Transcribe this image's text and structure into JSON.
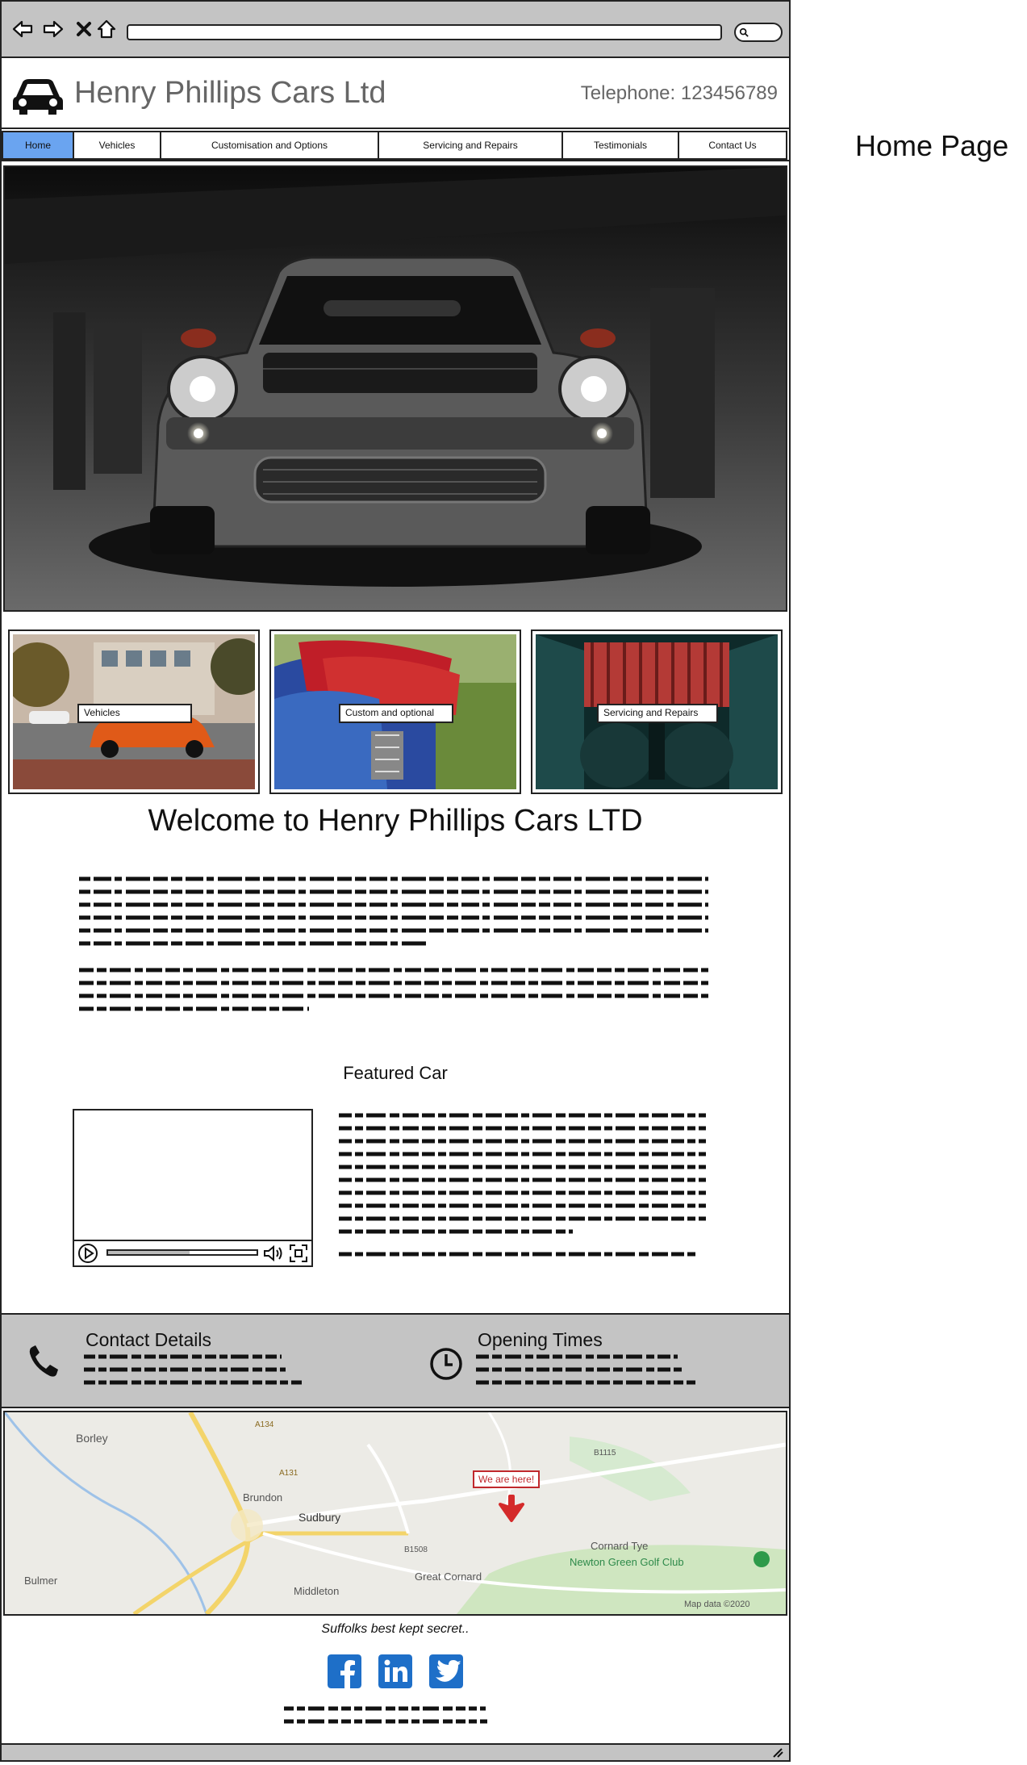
{
  "browser": {
    "back_icon": "arrow-left-icon",
    "forward_icon": "arrow-right-icon",
    "close_icon": "close-icon",
    "home_icon": "home-icon",
    "search_icon": "search-icon"
  },
  "header": {
    "logo_icon": "car-icon",
    "title": "Henry Phillips Cars Ltd",
    "telephone": "Telephone: 123456789"
  },
  "nav": {
    "items": [
      {
        "label": "Home",
        "active": true
      },
      {
        "label": "Vehicles",
        "active": false
      },
      {
        "label": "Customisation and Options",
        "active": false
      },
      {
        "label": "Servicing and Repairs",
        "active": false
      },
      {
        "label": "Testimonials",
        "active": false
      },
      {
        "label": "Contact Us",
        "active": false
      }
    ]
  },
  "tiles": [
    {
      "label": "Vehicles"
    },
    {
      "label": "Custom and optional"
    },
    {
      "label": "Servicing and Repairs"
    }
  ],
  "main": {
    "welcome": "Welcome to Henry Phillips Cars LTD",
    "featured_title": "Featured Car"
  },
  "contact": {
    "title": "Contact Details",
    "icon": "phone-icon"
  },
  "opening": {
    "title": "Opening Times",
    "icon": "clock-icon"
  },
  "map": {
    "places": [
      "Borley",
      "Brundon",
      "Sudbury",
      "Bulmer",
      "Middleton",
      "Great Cornard",
      "Cornard Tye",
      "Newton Green Golf Club"
    ],
    "roads": [
      "A134",
      "A131",
      "B1115",
      "B1508"
    ],
    "marker": "We are here!",
    "attribution": "Map data ©2020"
  },
  "footer": {
    "tagline": "Suffolks best kept secret..",
    "social": [
      "facebook-icon",
      "linkedin-icon",
      "twitter-icon"
    ]
  },
  "annotation": {
    "page_label": "Home Page"
  },
  "colors": {
    "nav_active": "#6aa4f0",
    "band_gray": "#c4c4c4",
    "social_blue": "#1e6fc8",
    "marker_red": "#c0282c"
  }
}
